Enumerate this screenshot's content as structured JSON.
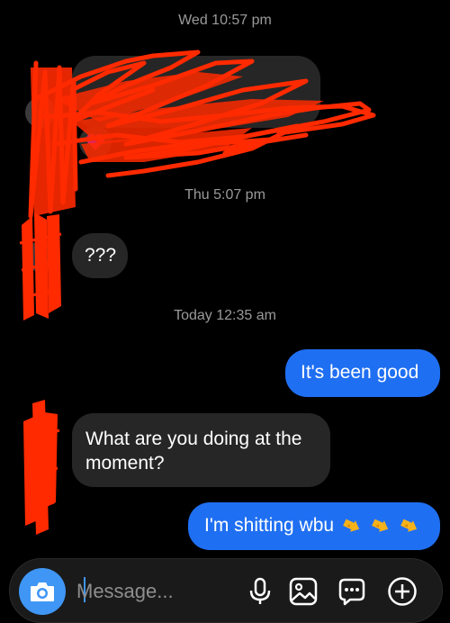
{
  "timestamps": {
    "t1": "Wed 10:57 pm",
    "t2": "Thu 5:07 pm",
    "t3": "Today 12:35 am"
  },
  "messages": [
    {
      "from": "them",
      "text": "",
      "redacted": true
    },
    {
      "from": "them",
      "text": "???"
    },
    {
      "from": "me",
      "text": "It's been good"
    },
    {
      "from": "them",
      "text": "What are you doing at the moment?"
    },
    {
      "from": "me",
      "text": "I'm shitting wbu",
      "emoji": [
        "pointing-hand-emoji",
        "pointing-hand-emoji",
        "pointing-hand-emoji"
      ]
    }
  ],
  "composer": {
    "placeholder": "Message...",
    "icons": [
      "camera-icon",
      "microphone-icon",
      "gallery-icon",
      "sticker-chat-icon",
      "plus-icon"
    ]
  },
  "colors": {
    "background": "#000000",
    "received_bubble": "#262626",
    "sent_bubble": "#1f6ff2",
    "camera_button": "#3f96f5",
    "redaction": "#ff2a00"
  }
}
